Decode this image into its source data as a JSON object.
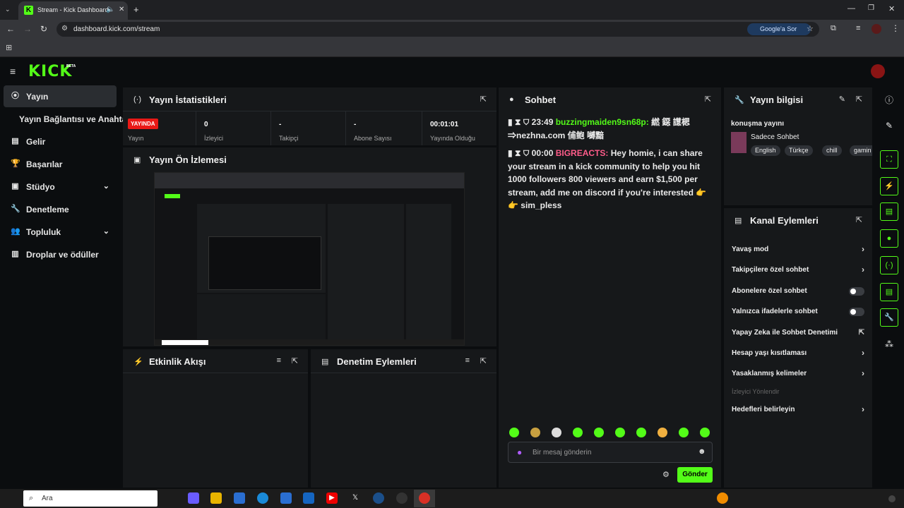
{
  "browser": {
    "tab_title": "Stream - Kick Dashboard",
    "url": "dashboard.kick.com/stream",
    "google_button": "Google'a Sor"
  },
  "header": {
    "logo": "KICK",
    "beta": "BETA"
  },
  "sidebar": {
    "items": [
      {
        "label": "Yayın",
        "icon": "broadcast-icon"
      },
      {
        "label": "Yayın Bağlantısı ve Anahtarı"
      },
      {
        "label": "Gelir",
        "icon": "chart-icon"
      },
      {
        "label": "Başarılar",
        "icon": "trophy-icon"
      },
      {
        "label": "Stüdyo",
        "icon": "studio-icon"
      },
      {
        "label": "Denetleme",
        "icon": "wrench-icon"
      },
      {
        "label": "Topluluk",
        "icon": "people-icon"
      },
      {
        "label": "Droplar ve ödüller",
        "icon": "gift-icon"
      }
    ]
  },
  "stats": {
    "title": "Yayın İstatistikleri",
    "live_badge": "YAYINDA",
    "live_label": "Yayın",
    "items": [
      {
        "value": "0",
        "label": "İzleyici"
      },
      {
        "value": "-",
        "label": "Takipçi"
      },
      {
        "value": "-",
        "label": "Abone Sayısı"
      },
      {
        "value": "00:01:01",
        "label": "Yayında Olduğu"
      }
    ]
  },
  "preview": {
    "title": "Yayın Ön İzlemesi"
  },
  "activity": {
    "title": "Etkinlik Akışı"
  },
  "moderation": {
    "title": "Denetim Eylemleri"
  },
  "chat": {
    "title": "Sohbet",
    "messages": [
      {
        "time": "23:49",
        "user": "buzzingmaiden9sn68p:",
        "text": "繎 鐚 譿楒 ⇒nezhna.com 俌鲍 嚩黯"
      },
      {
        "time": "00:00",
        "user": "BIGREACTS:",
        "text": "Hey homie, i can share your stream in a kick community to help you hit 1000 followers 800 viewers and earn $1,500 per stream, add me on discord if you're interested 👉 👉 sim_pless"
      }
    ],
    "placeholder": "Bir mesaj gönderin",
    "send_label": "Gönder"
  },
  "stream_info": {
    "title": "Yayın bilgisi",
    "stream_title": "konuşma yayını",
    "category": "Sadece Sohbet",
    "tags": [
      "English",
      "Türkçe",
      "chill",
      "gamin"
    ]
  },
  "channel_actions": {
    "title": "Kanal Eylemleri",
    "items": [
      {
        "label": "Yavaş mod",
        "control": "chevron"
      },
      {
        "label": "Takipçilere özel sohbet",
        "control": "chevron"
      },
      {
        "label": "Abonelere özel sohbet",
        "control": "toggle"
      },
      {
        "label": "Yalnızca ifadelerle sohbet",
        "control": "toggle"
      },
      {
        "label": "Yapay Zeka ile Sohbet Denetimi",
        "control": "external"
      },
      {
        "label": "Hesap yaşı kısıtlaması",
        "control": "chevron"
      },
      {
        "label": "Yasaklanmış kelimeler",
        "control": "chevron"
      }
    ],
    "section_label": "İzleyici Yönlendir",
    "raid_label": "Hedefleri belirleyin"
  },
  "taskbar": {
    "search_placeholder": "Ara"
  }
}
